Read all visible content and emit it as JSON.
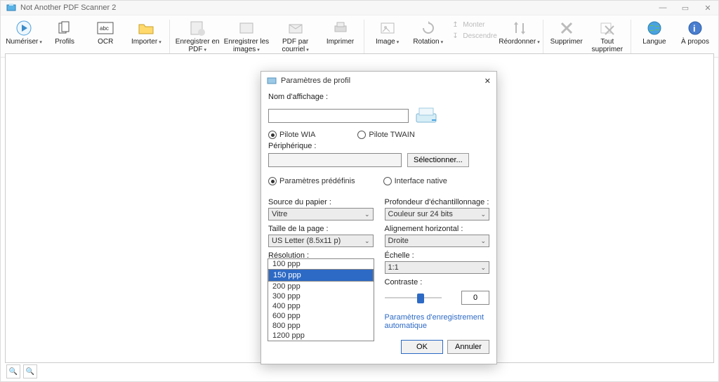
{
  "title": "Not Another PDF Scanner 2",
  "toolbar": {
    "scan": "Numériser",
    "profiles": "Profils",
    "ocr": "OCR",
    "import": "Importer",
    "save_pdf": "Enregistrer en PDF",
    "save_img": "Enregistrer les images",
    "email_pdf": "PDF par courriel",
    "print": "Imprimer",
    "image": "Image",
    "rotate": "Rotation",
    "move_up": "Monter",
    "move_down": "Descendre",
    "reorder": "Réordonner",
    "delete": "Supprimer",
    "delete_all": "Tout supprimer",
    "language": "Langue",
    "about": "À propos"
  },
  "dialog": {
    "title": "Paramètres de profil",
    "display_name_label": "Nom d'affichage :",
    "display_name_value": "",
    "driver_wia": "Pilote WIA",
    "driver_twain": "Pilote TWAIN",
    "device_label": "Périphérique :",
    "device_value": "",
    "select_device_btn": "Sélectionner...",
    "predef_params": "Paramètres prédéfinis",
    "native_interface": "Interface native",
    "left": {
      "paper_source_label": "Source du papier :",
      "paper_source_value": "Vitre",
      "page_size_label": "Taille de la page :",
      "page_size_value": "US Letter (8.5x11 p)",
      "resolution_label": "Résolution :",
      "resolution_value": "150 ppp",
      "resolution_options": [
        "100 ppp",
        "150 ppp",
        "200 ppp",
        "300 ppp",
        "400 ppp",
        "600 ppp",
        "800 ppp",
        "1200 ppp"
      ]
    },
    "right": {
      "bit_depth_label": "Profondeur d'échantillonnage :",
      "bit_depth_value": "Couleur sur 24 bits",
      "halign_label": "Alignement horizontal :",
      "halign_value": "Droite",
      "scale_label": "Échelle :",
      "scale_value": "1:1",
      "contrast_label": "Contraste :",
      "contrast_value": "0",
      "autosave_link": "Paramètres d'enregistrement automatique"
    },
    "ok": "OK",
    "cancel": "Annuler"
  }
}
